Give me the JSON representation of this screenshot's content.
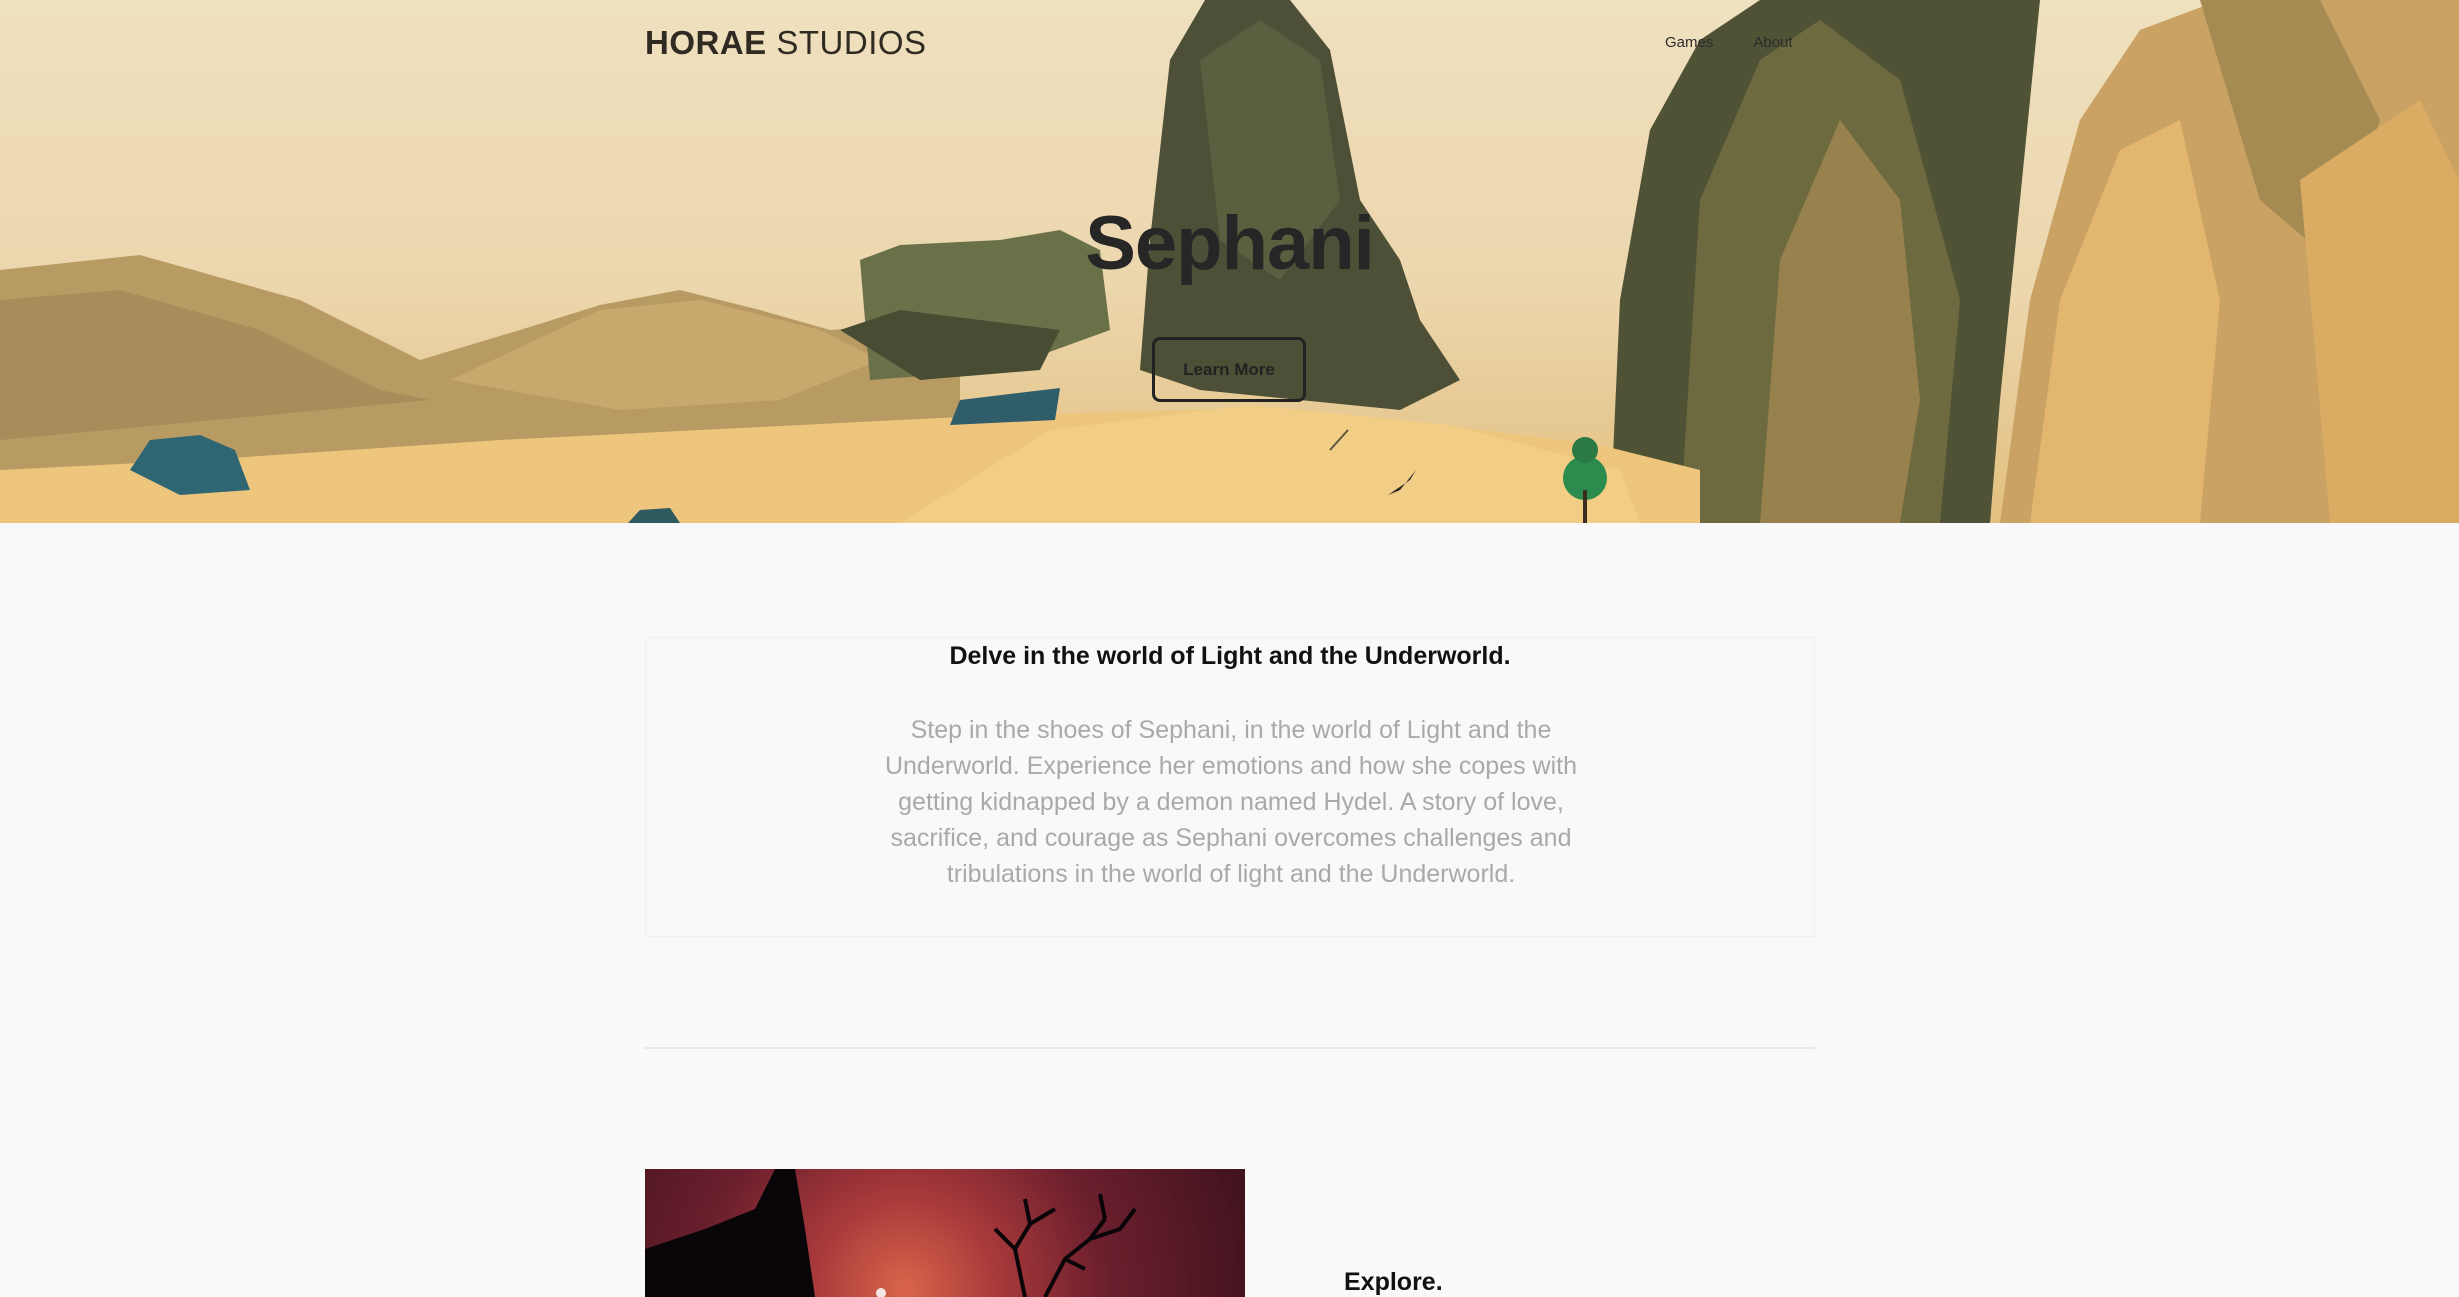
{
  "header": {
    "logo_bold": "HORAE",
    "logo_light": "STUDIOS",
    "nav": [
      {
        "label": "Games"
      },
      {
        "label": "About"
      }
    ]
  },
  "hero": {
    "title": "Sephani",
    "button_label": "Learn More"
  },
  "intro": {
    "heading": "Delve in the world of Light and the Underworld.",
    "body": "Step in the shoes of Sephani, in the world of Light and the Underworld. Experience her emotions and how she copes with getting kidnapped by a demon named Hydel. A story of love, sacrifice, and courage as Sephani overcomes challenges and tribulations in the world of light and the Underworld."
  },
  "feature": {
    "title": "Explore."
  },
  "colors": {
    "page_bg": "#f9f9f9",
    "hero_sky": "#efe0bf",
    "rock_dark": "#4d5036",
    "sand": "#f0c77a",
    "text_dark": "#262626",
    "text_muted": "#a9a9a9"
  }
}
